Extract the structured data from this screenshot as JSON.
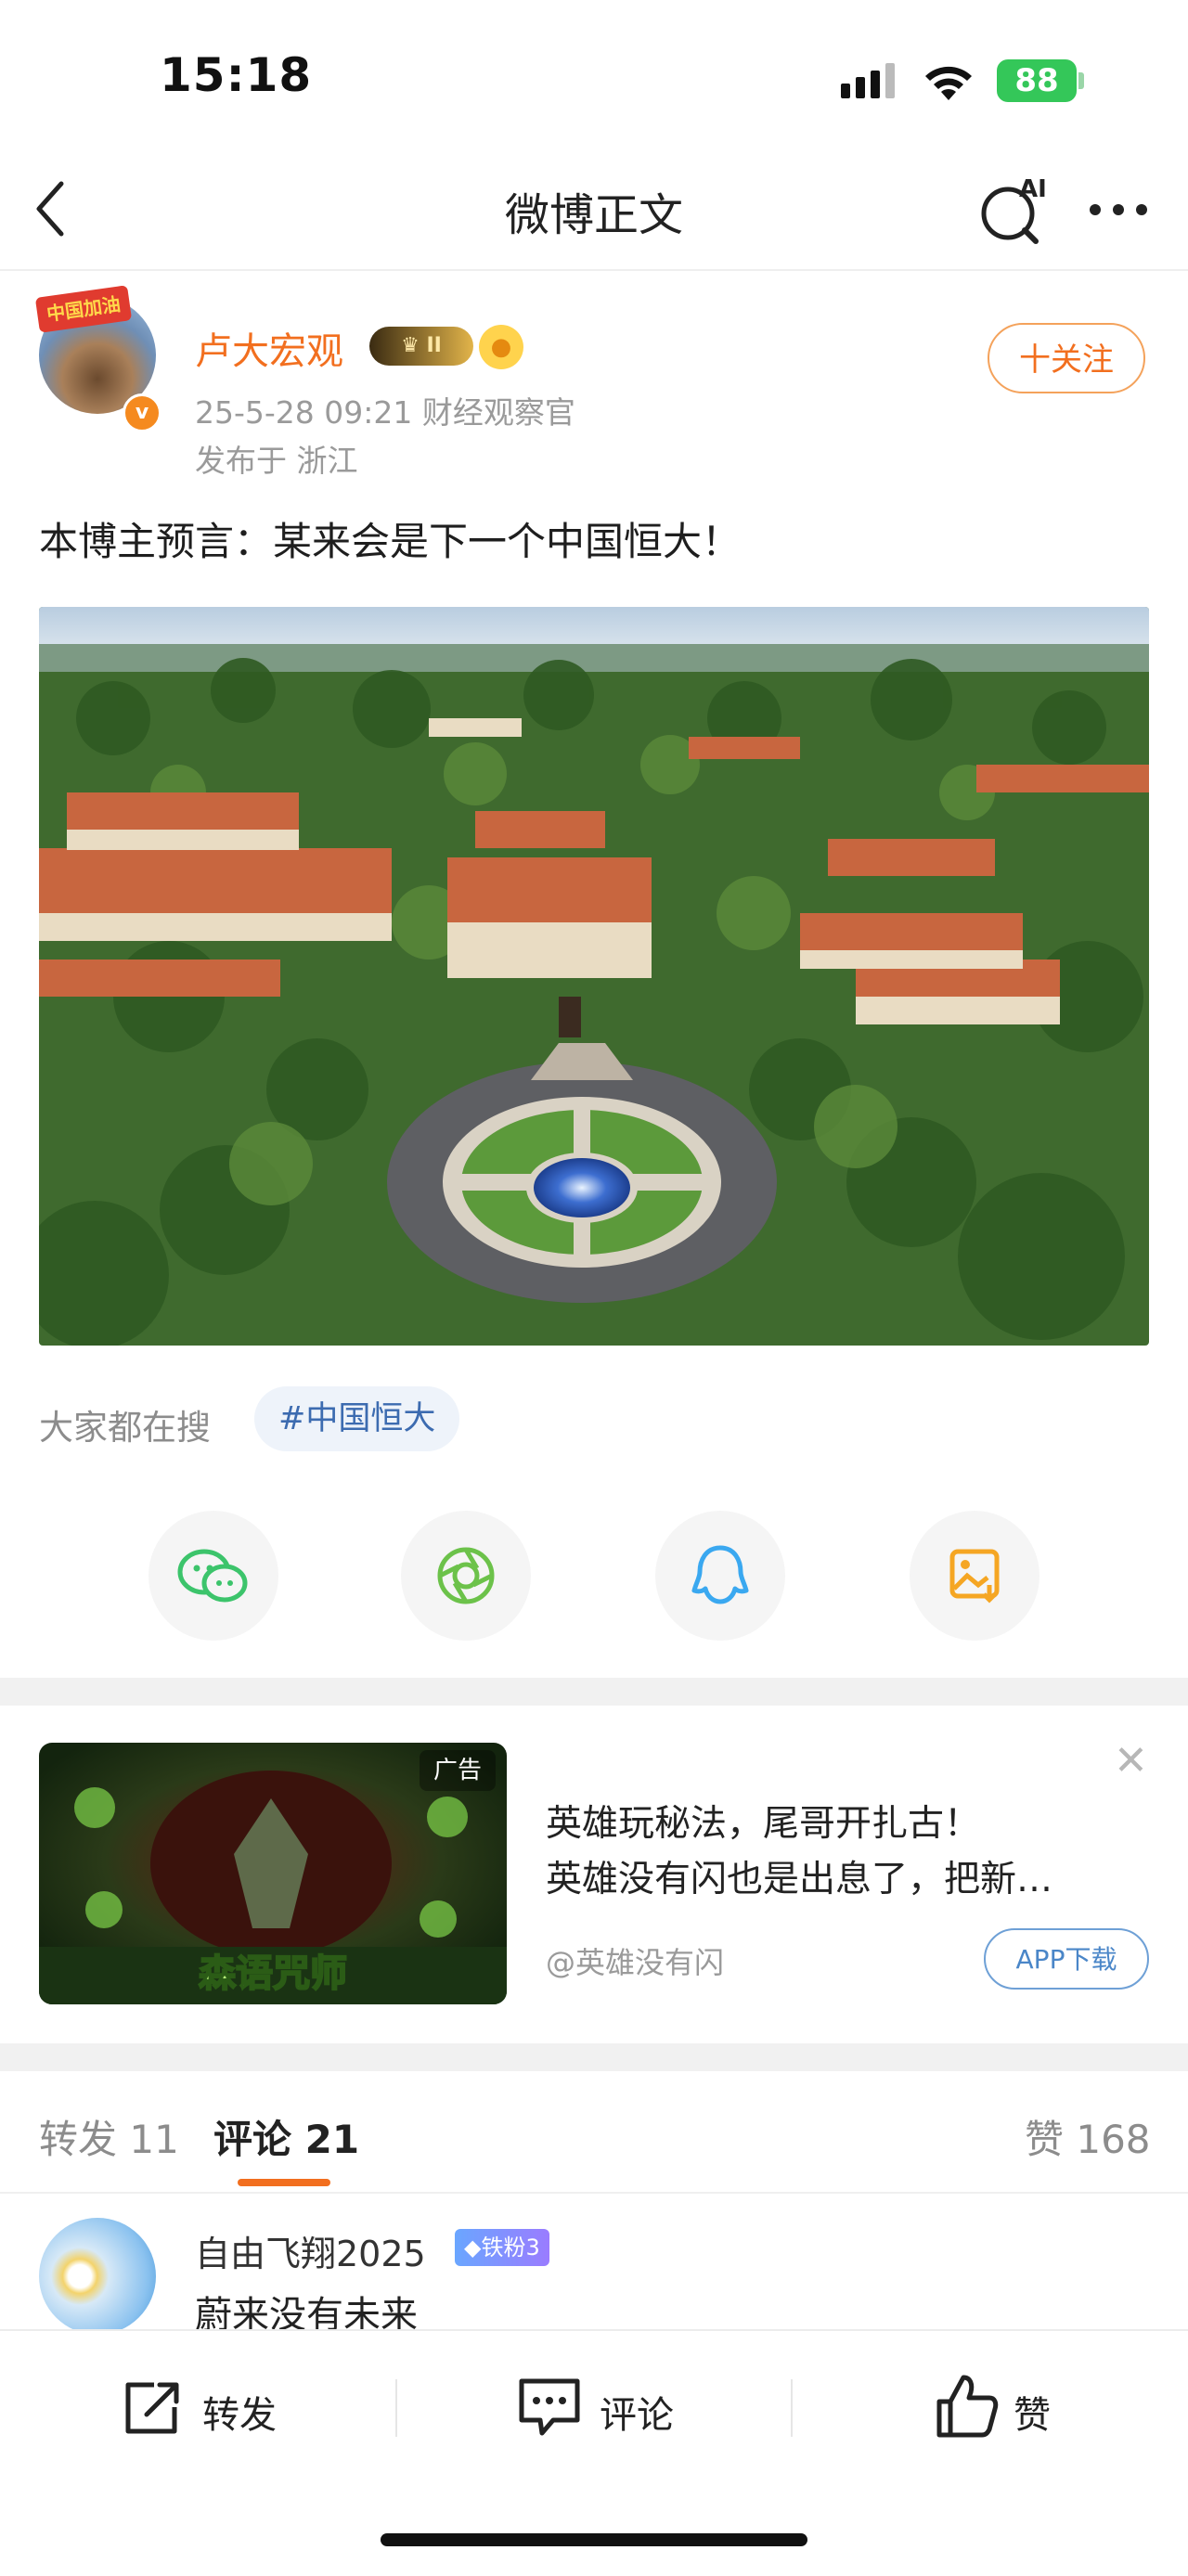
{
  "status_bar": {
    "time": "15:18",
    "battery": "88"
  },
  "nav": {
    "title": "微博正文"
  },
  "author": {
    "name": "卢大宏观",
    "avatar_banner": "中国加油",
    "badge_level": "II",
    "meta": "25-5-28 09:21  财经观察官",
    "location": "发布于 浙江",
    "follow_label": "十关注"
  },
  "post": {
    "text": "本博主预言：某来会是下一个中国恒大！",
    "search_label": "大家都在搜",
    "hashtag": "#中国恒大"
  },
  "share_icons": [
    "wechat-icon",
    "moments-icon",
    "qq-icon",
    "save-image-icon"
  ],
  "ad": {
    "tag": "广告",
    "title_line1": "英雄玩秘法，尾哥开扎古！",
    "title_line2": "英雄没有闪也是出息了，把新…",
    "source": "@英雄没有闪",
    "button": "APP下载",
    "image_caption": "森语咒师"
  },
  "tabs": {
    "repost": "转发 11",
    "comment": "评论 21",
    "likes": "赞 168"
  },
  "comment": {
    "name": "自由飞翔2025",
    "fan_badge": "◆铁粉3",
    "text": "蔚来没有未来"
  },
  "bottom_bar": {
    "repost": "转发",
    "comment": "评论",
    "like": "赞"
  },
  "colors": {
    "accent": "#f26f1f",
    "link": "#3c6bb0"
  }
}
